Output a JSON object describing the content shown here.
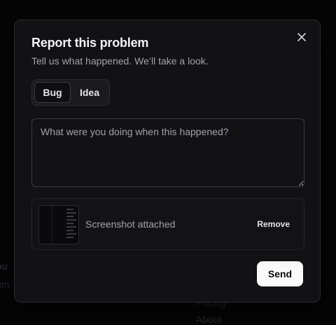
{
  "background": {
    "text1": "ou",
    "text2": "um",
    "text3": ")",
    "link1": "Pricing",
    "link2": "About"
  },
  "modal": {
    "title": "Report this problem",
    "subtitle": "Tell us what happened. We’ll take a look.",
    "close_icon": "close-icon",
    "toggle": {
      "options": [
        "Bug",
        "Idea"
      ],
      "selected": "Bug"
    },
    "textarea": {
      "value": "",
      "placeholder": "What were you doing when this happened?"
    },
    "attachment": {
      "label": "Screenshot attached",
      "remove_label": "Remove"
    },
    "send_label": "Send"
  },
  "colors": {
    "modal_bg": "#121215",
    "send_bg": "#fafafa",
    "muted_text": "#a1a1aa"
  }
}
